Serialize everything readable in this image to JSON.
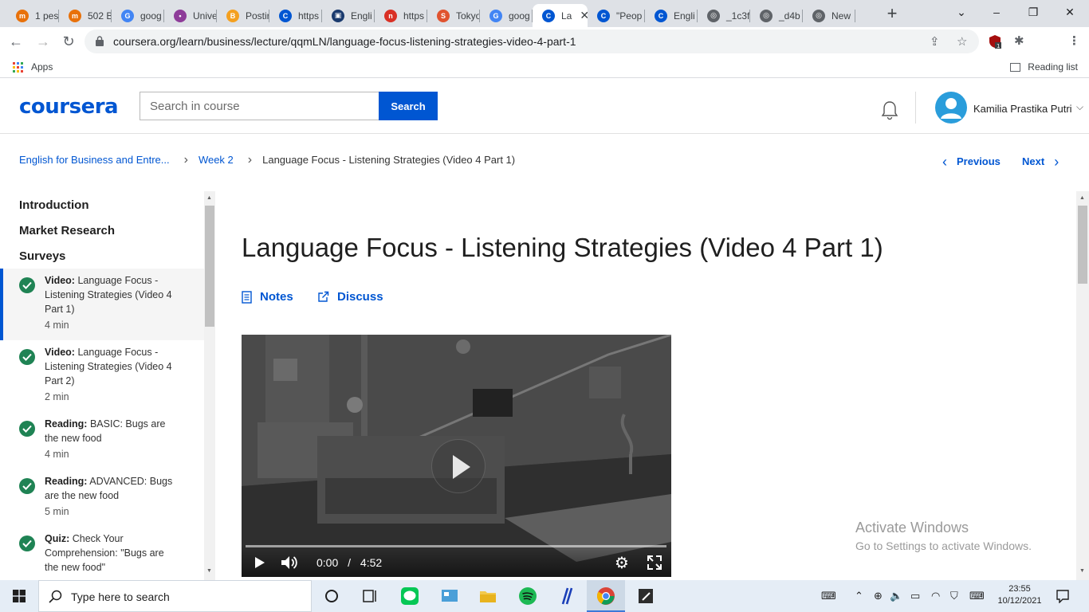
{
  "browser": {
    "tabs": [
      {
        "label": "1 pes",
        "fav_color": "#e8710a",
        "fav_char": "m"
      },
      {
        "label": "502 B",
        "fav_color": "#e8710a",
        "fav_char": "m"
      },
      {
        "label": "goog",
        "fav_color": "#4285f4",
        "fav_char": "G"
      },
      {
        "label": "Unive",
        "fav_color": "#8e3c99",
        "fav_char": "•"
      },
      {
        "label": "Postir",
        "fav_color": "#f4a020",
        "fav_char": "B"
      },
      {
        "label": "https",
        "fav_color": "#0056d2",
        "fav_char": "C"
      },
      {
        "label": "Engli",
        "fav_color": "#1a3a6e",
        "fav_char": "▣"
      },
      {
        "label": "https",
        "fav_color": "#d93025",
        "fav_char": "n"
      },
      {
        "label": "Tokyo",
        "fav_color": "#e0532f",
        "fav_char": "S"
      },
      {
        "label": "goog",
        "fav_color": "#4285f4",
        "fav_char": "G"
      },
      {
        "label": "La",
        "fav_color": "#0056d2",
        "fav_char": "C",
        "active": true
      },
      {
        "label": "\"Peop",
        "fav_color": "#0056d2",
        "fav_char": "C"
      },
      {
        "label": "Engli",
        "fav_color": "#0056d2",
        "fav_char": "C"
      },
      {
        "label": "_1c3f",
        "fav_color": "#5f6368",
        "fav_char": "◎"
      },
      {
        "label": "_d4b",
        "fav_color": "#5f6368",
        "fav_char": "◎"
      },
      {
        "label": "New",
        "fav_color": "#5f6368",
        "fav_char": "◎"
      }
    ],
    "url": "coursera.org/learn/business/lecture/qqmLN/language-focus-listening-strategies-video-4-part-1",
    "apps_label": "Apps",
    "reading_list_label": "Reading list"
  },
  "header": {
    "logo": "coursera",
    "search_placeholder": "Search in course",
    "search_button": "Search",
    "user_name": "Kamilia Prastika Putri",
    "brand_color": "#0056d2"
  },
  "breadcrumb": {
    "course": "English for Business and Entre...",
    "week": "Week 2",
    "current": "Language Focus - Listening Strategies (Video 4 Part 1)"
  },
  "pager": {
    "previous": "Previous",
    "next": "Next"
  },
  "sidebar": {
    "sections": [
      "Introduction",
      "Market Research",
      "Surveys"
    ],
    "items": [
      {
        "type": "Video:",
        "title": "Language Focus - Listening Strategies (Video 4 Part 1)",
        "duration": "4 min",
        "active": true
      },
      {
        "type": "Video:",
        "title": "Language Focus - Listening Strategies (Video 4 Part 2)",
        "duration": "2 min"
      },
      {
        "type": "Reading:",
        "title": "BASIC: Bugs are the new food",
        "duration": "4 min"
      },
      {
        "type": "Reading:",
        "title": "ADVANCED: Bugs are the new food",
        "duration": "5 min"
      },
      {
        "type": "Quiz:",
        "title": "Check Your Comprehension: \"Bugs are the new food\"",
        "duration": ""
      }
    ]
  },
  "main": {
    "title": "Language Focus - Listening Strategies (Video 4 Part 1)",
    "notes_label": "Notes",
    "discuss_label": "Discuss"
  },
  "video": {
    "current_time": "0:00",
    "separator": "/",
    "duration": "4:52",
    "progress": 0
  },
  "watermark": {
    "line1": "Activate Windows",
    "line2": "Go to Settings to activate Windows."
  },
  "taskbar": {
    "search_placeholder": "Type here to search",
    "time": "23:55",
    "date": "10/12/2021"
  }
}
